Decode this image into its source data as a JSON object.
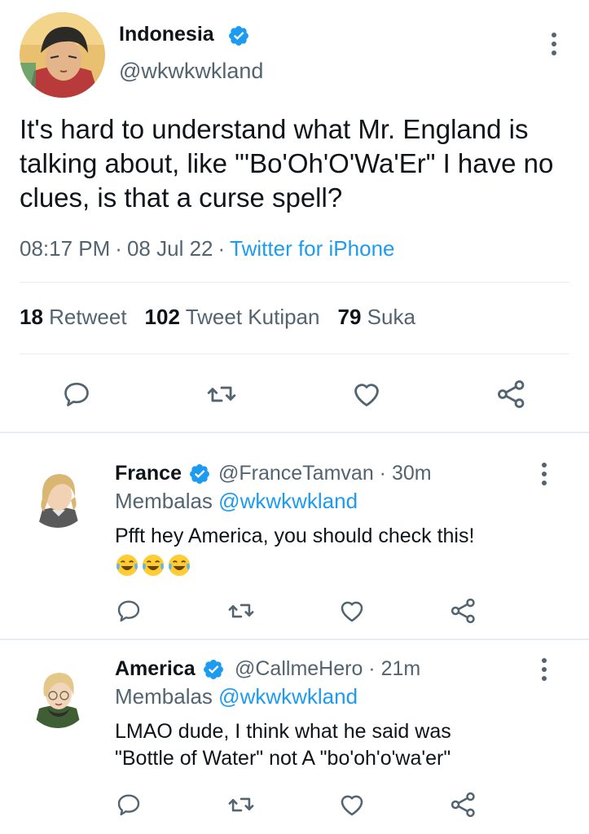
{
  "main_tweet": {
    "name": "Indonesia",
    "handle": "@wkwkwkland",
    "text": "It's hard to understand what Mr. England is talking about, like \"'Bo'Oh'O'Wa'Er\" I have no clues, is that a curse spell?",
    "time": "08:17 PM",
    "date": "08 Jul 22",
    "separator": "·",
    "source": "Twitter for iPhone",
    "stats": {
      "retweets": "18",
      "retweets_label": "Retweet",
      "quotes": "102",
      "quotes_label": "Tweet Kutipan",
      "likes": "79",
      "likes_label": "Suka"
    },
    "actions": [
      "reply-icon",
      "retweet-icon",
      "like-icon",
      "share-icon"
    ]
  },
  "replies": [
    {
      "name": "France",
      "handle": "@FranceTamvan · 30m",
      "replying_label": "Membalas",
      "replying_to": "@wkwkwkland",
      "text": "Pfft hey America, you should check this!",
      "emoji": [
        "face-with-tears-of-joy",
        "face-with-tears-of-joy",
        "face-with-tears-of-joy"
      ]
    },
    {
      "name": "America",
      "handle": "@CallmeHero · 21m",
      "replying_label": "Membalas",
      "replying_to": "@wkwkwkland",
      "text": "LMAO dude, I think what he said was \"Bottle of Water\" not A \"bo'oh'o'wa'er\""
    }
  ],
  "colors": {
    "accent": "#1d9bf0",
    "secondary_text": "#536471",
    "divider": "#e6ecf0"
  }
}
